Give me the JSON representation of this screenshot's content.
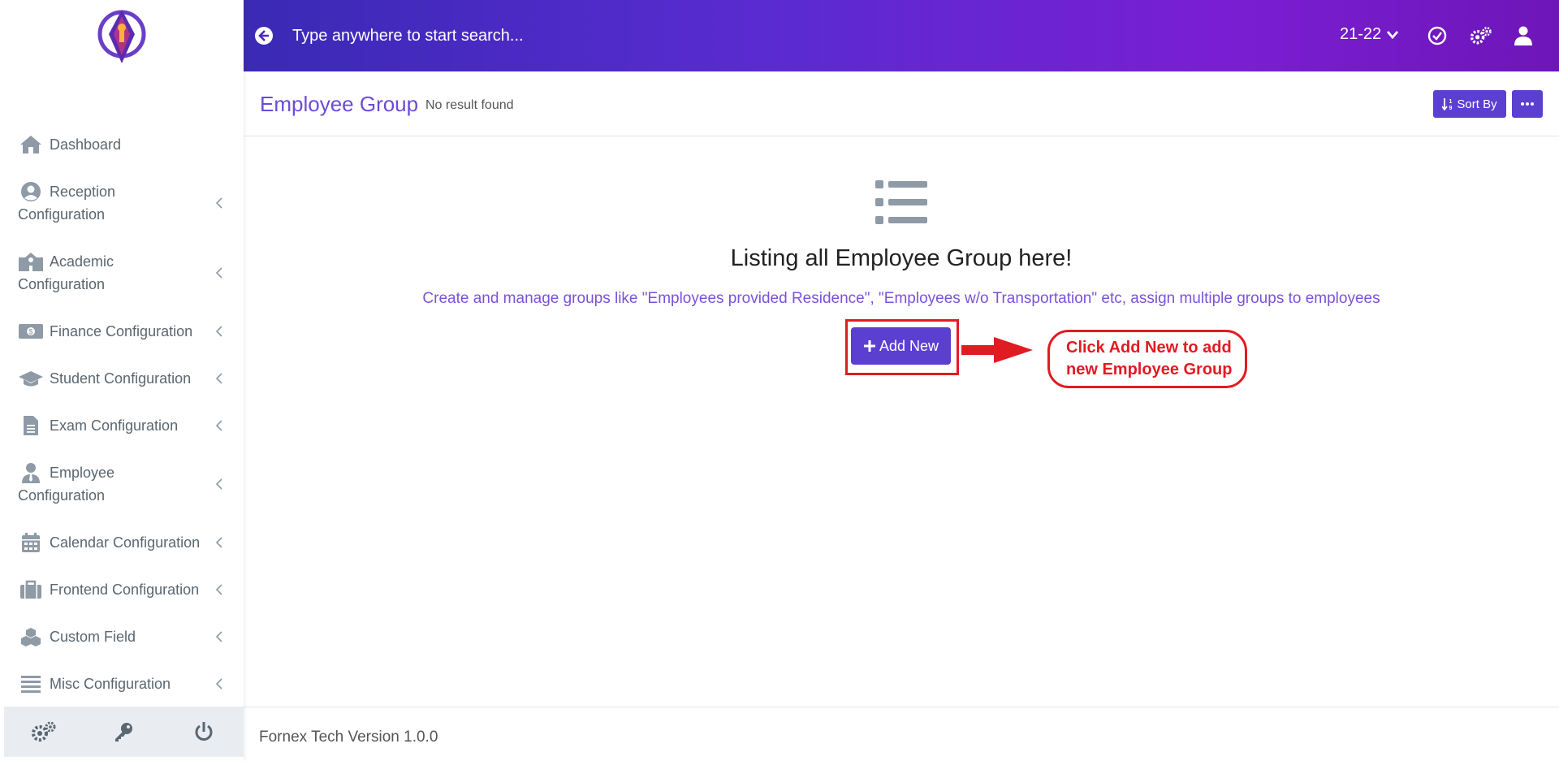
{
  "colors": {
    "accent": "#5b3fd1",
    "annotation": "#e11b22",
    "title": "#6c4bd8",
    "icon": "#8e9aa6"
  },
  "header": {
    "search_placeholder": "Type anywhere to start search...",
    "session": "21-22"
  },
  "sidebar": {
    "items": [
      {
        "label": "Dashboard",
        "icon": "home-icon"
      },
      {
        "label_line1": "Reception",
        "label_line2": "Configuration",
        "icon": "user-circle-icon"
      },
      {
        "label_line1": "Academic",
        "label_line2": "Configuration",
        "icon": "school-icon"
      },
      {
        "label": "Finance Configuration",
        "icon": "money-icon"
      },
      {
        "label": "Student Configuration",
        "icon": "graduation-cap-icon"
      },
      {
        "label": "Exam Configuration",
        "icon": "file-icon"
      },
      {
        "label_line1": "Employee",
        "label_line2": "Configuration",
        "icon": "user-tie-icon"
      },
      {
        "label": "Calendar Configuration",
        "icon": "calendar-icon"
      },
      {
        "label": "Frontend Configuration",
        "icon": "briefcase-icon"
      },
      {
        "label": "Custom Field",
        "icon": "cubes-icon"
      },
      {
        "label": "Misc Configuration",
        "icon": "bars-icon"
      }
    ]
  },
  "page": {
    "title": "Employee Group",
    "result_text": "No result found",
    "sort_label": "Sort By"
  },
  "empty_state": {
    "heading": "Listing all Employee Group here!",
    "description": "Create and manage groups like \"Employees provided Residence\", \"Employees w/o Transportation\" etc, assign multiple groups to employees",
    "add_label": "Add New"
  },
  "annotation": {
    "line1": "Click Add New to add",
    "line2": "new Employee Group"
  },
  "footer": {
    "version": "Fornex Tech Version 1.0.0"
  }
}
